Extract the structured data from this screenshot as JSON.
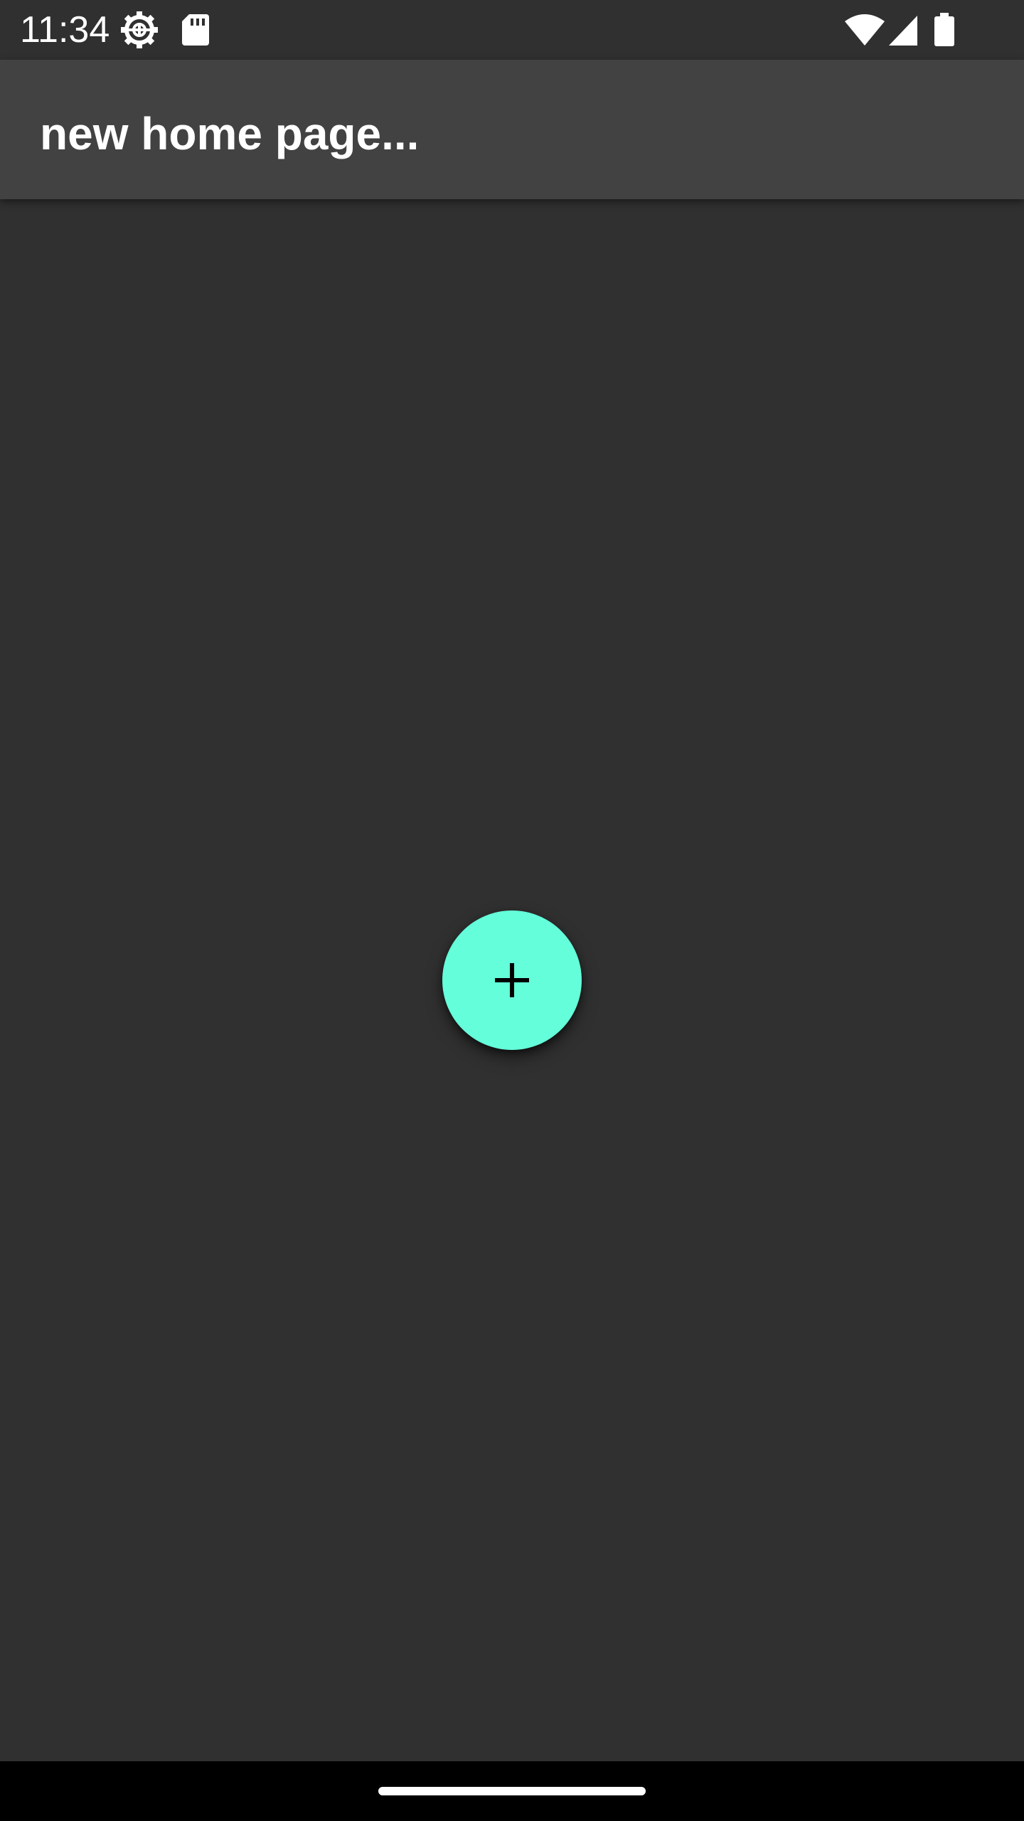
{
  "status_bar": {
    "time": "11:34",
    "icons": [
      "gear-icon",
      "sd-card-icon",
      "wifi-icon",
      "cell-signal-icon",
      "battery-icon"
    ]
  },
  "app_bar": {
    "title": "new home page..."
  },
  "fab": {
    "icon": "add-icon"
  },
  "colors": {
    "background": "#303030",
    "app_bar": "#424242",
    "accent": "#64ffda",
    "nav_bar": "#000000",
    "text": "#ffffff"
  }
}
